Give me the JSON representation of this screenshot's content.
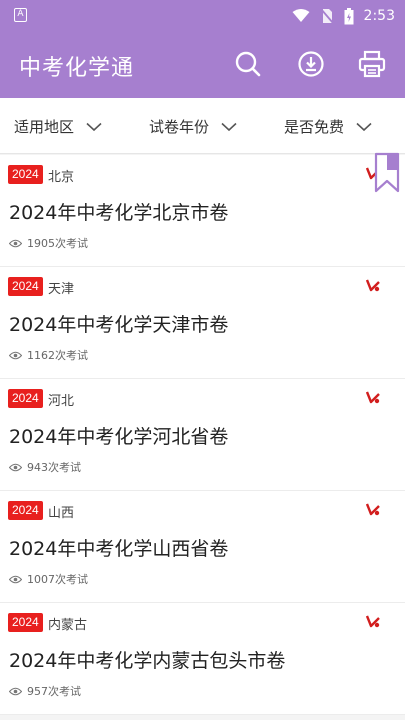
{
  "status": {
    "time": "2:53"
  },
  "app": {
    "title": "中考化学通",
    "icons": [
      "search-icon",
      "download-icon",
      "print-icon"
    ]
  },
  "filters": [
    {
      "label": "适用地区"
    },
    {
      "label": "试卷年份"
    },
    {
      "label": "是否免费"
    }
  ],
  "colors": {
    "accent": "#a67fcf",
    "badge": "#e8201e"
  },
  "items": [
    {
      "year": "2024",
      "region": "北京",
      "title": "2024年中考化学北京市卷",
      "views": "1905次考试"
    },
    {
      "year": "2024",
      "region": "天津",
      "title": "2024年中考化学天津市卷",
      "views": "1162次考试"
    },
    {
      "year": "2024",
      "region": "河北",
      "title": "2024年中考化学河北省卷",
      "views": "943次考试"
    },
    {
      "year": "2024",
      "region": "山西",
      "title": "2024年中考化学山西省卷",
      "views": "1007次考试"
    },
    {
      "year": "2024",
      "region": "内蒙古",
      "title": "2024年中考化学内蒙古包头市卷",
      "views": "957次考试"
    }
  ]
}
